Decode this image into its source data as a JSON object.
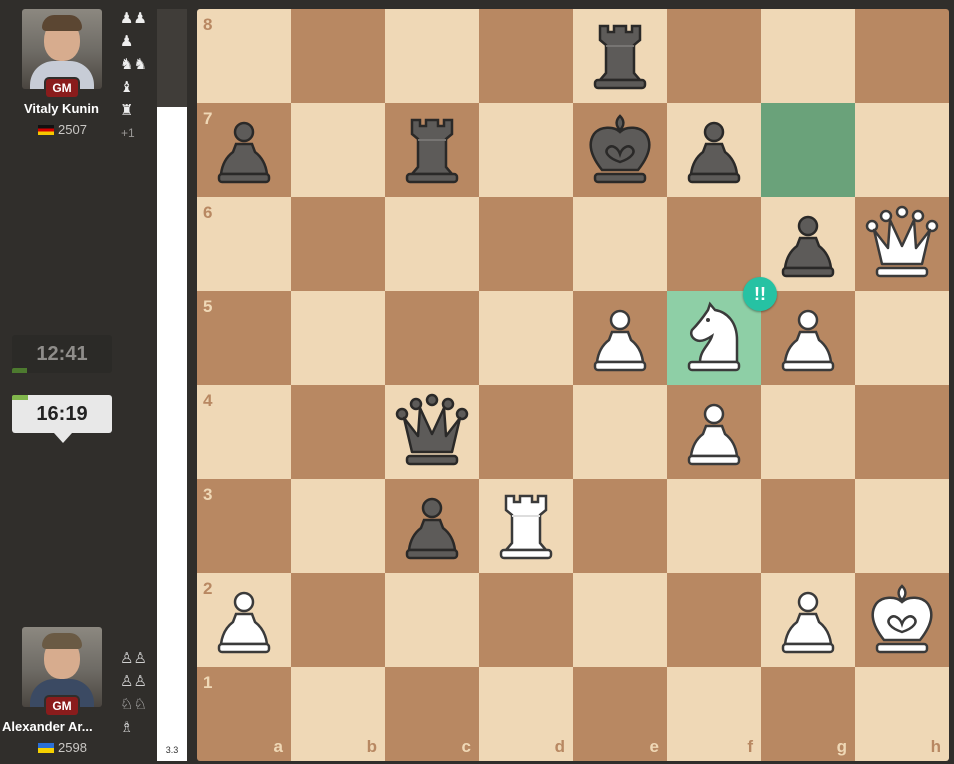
{
  "players": {
    "top": {
      "name": "Vitaly Kunin",
      "title": "GM",
      "rating": "2507",
      "flag": "de",
      "captured": [
        "♟♟",
        "♟",
        "♞♞",
        "♝",
        "♜"
      ],
      "material_diff": "+1"
    },
    "bottom": {
      "name": "Alexander Ar...",
      "title": "GM",
      "rating": "2598",
      "flag": "ua",
      "captured": [
        "♙♙",
        "♙♙",
        "♘♘",
        "♗"
      ]
    }
  },
  "clocks": {
    "top": {
      "time": "12:41",
      "remaining_fraction": 0.15
    },
    "bottom": {
      "time": "16:19",
      "remaining_fraction": 0.16
    }
  },
  "eval": {
    "label": "3.3",
    "black_fraction": 0.13
  },
  "board": {
    "files": [
      "a",
      "b",
      "c",
      "d",
      "e",
      "f",
      "g",
      "h"
    ],
    "ranks": [
      "8",
      "7",
      "6",
      "5",
      "4",
      "3",
      "2",
      "1"
    ],
    "highlights": [
      "g7",
      "f5"
    ],
    "move_badge": {
      "square": "f5",
      "label": "!!"
    },
    "pieces": [
      {
        "square": "e8",
        "color": "b",
        "type": "r"
      },
      {
        "square": "a7",
        "color": "b",
        "type": "p"
      },
      {
        "square": "c7",
        "color": "b",
        "type": "r"
      },
      {
        "square": "e7",
        "color": "b",
        "type": "k"
      },
      {
        "square": "f7",
        "color": "b",
        "type": "p"
      },
      {
        "square": "g6",
        "color": "b",
        "type": "p"
      },
      {
        "square": "h6",
        "color": "w",
        "type": "q"
      },
      {
        "square": "e5",
        "color": "w",
        "type": "p"
      },
      {
        "square": "f5",
        "color": "w",
        "type": "n"
      },
      {
        "square": "g5",
        "color": "w",
        "type": "p"
      },
      {
        "square": "c4",
        "color": "b",
        "type": "q"
      },
      {
        "square": "f4",
        "color": "w",
        "type": "p"
      },
      {
        "square": "c3",
        "color": "b",
        "type": "p"
      },
      {
        "square": "d3",
        "color": "w",
        "type": "r"
      },
      {
        "square": "a2",
        "color": "w",
        "type": "p"
      },
      {
        "square": "g2",
        "color": "w",
        "type": "p"
      },
      {
        "square": "h2",
        "color": "w",
        "type": "k"
      }
    ]
  }
}
